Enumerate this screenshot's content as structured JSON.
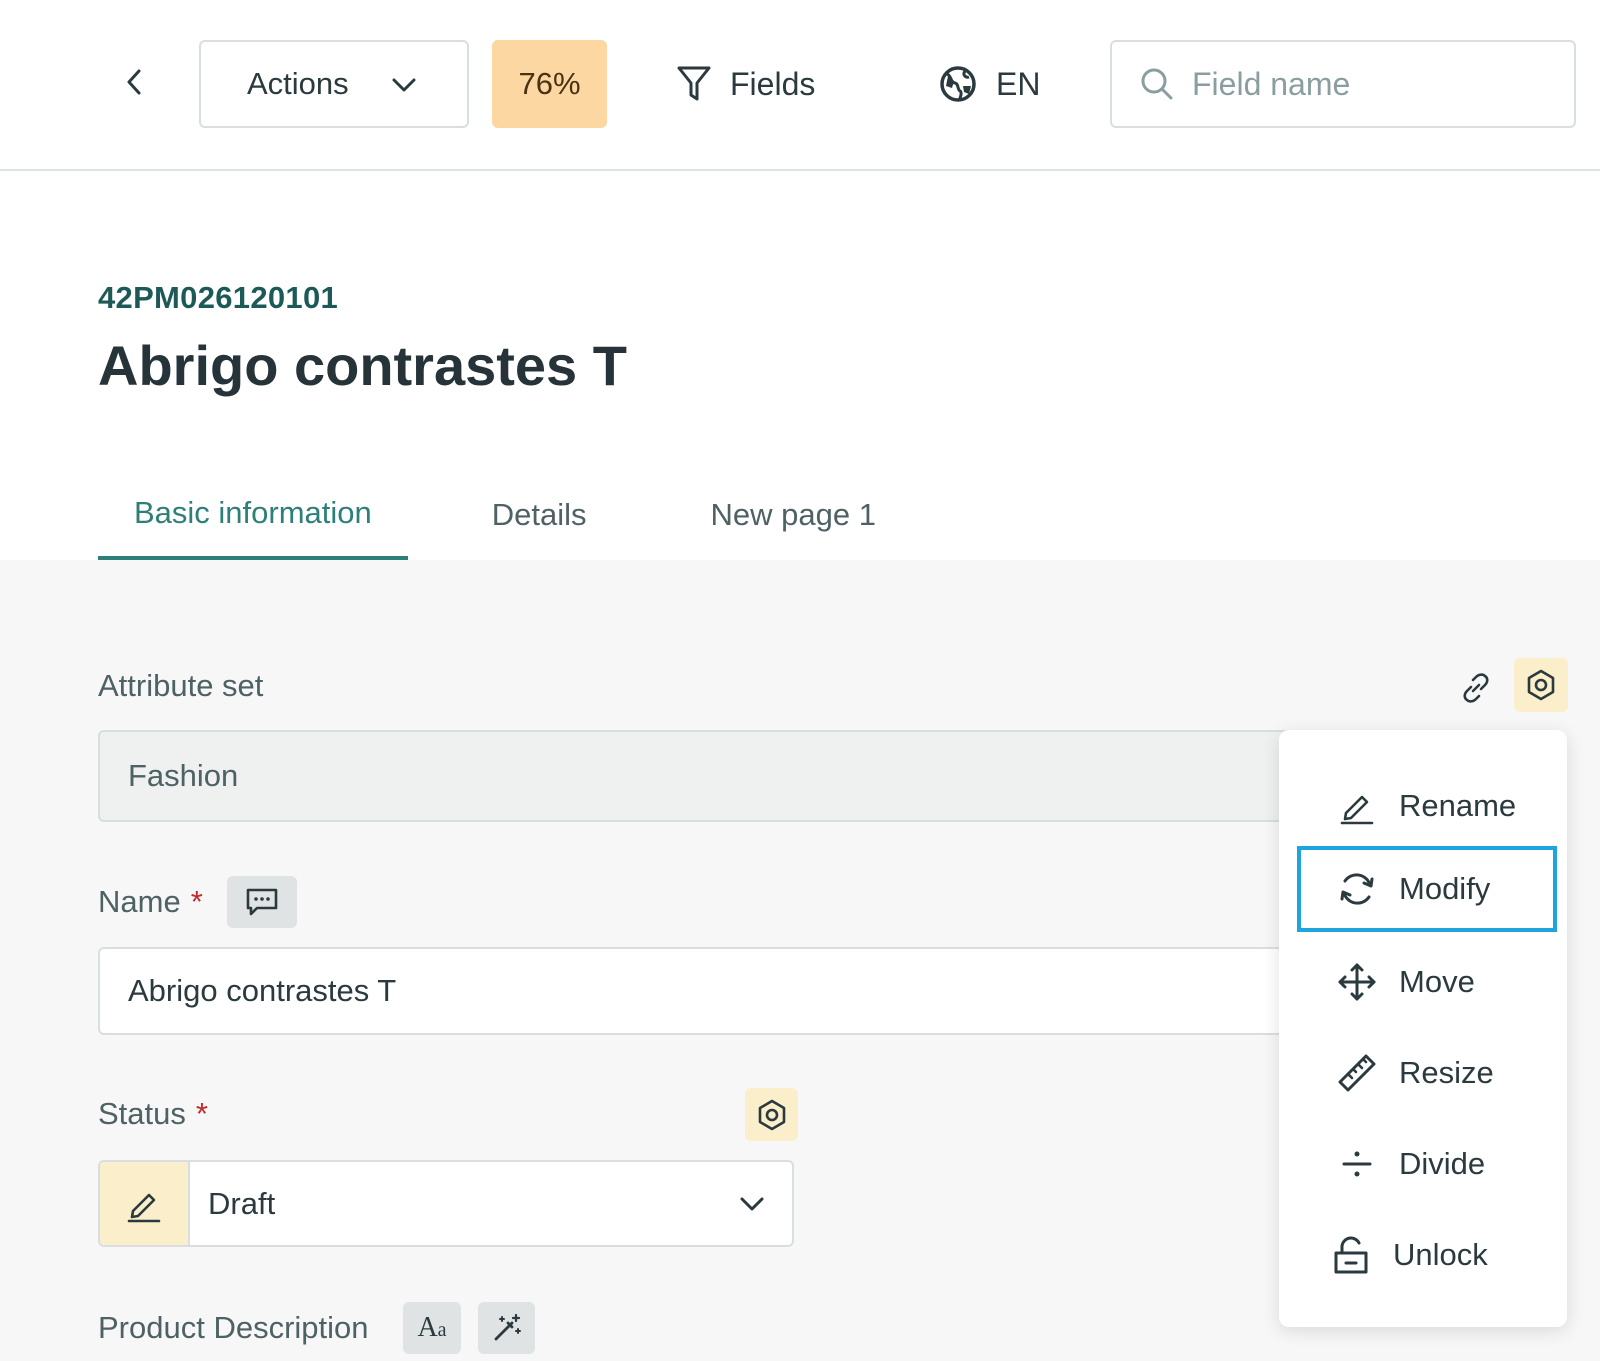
{
  "toolbar": {
    "actions_label": "Actions",
    "completeness": "76%",
    "fields_label": "Fields",
    "language": "EN",
    "search_placeholder": "Field name",
    "completeness_color": "#fdd7a1"
  },
  "product": {
    "code": "42PM026120101",
    "title": "Abrigo contrastes T"
  },
  "tabs": [
    {
      "label": "Basic information",
      "active": true
    },
    {
      "label": "Details",
      "active": false
    },
    {
      "label": "New page 1",
      "active": false
    }
  ],
  "fields": {
    "attribute_set": {
      "label": "Attribute set",
      "value": "Fashion"
    },
    "name": {
      "label": "Name",
      "required_mark": "*",
      "value": "Abrigo contrastes T"
    },
    "status": {
      "label": "Status",
      "required_mark": "*",
      "value": "Draft"
    },
    "product_description": {
      "label": "Product Description"
    }
  },
  "context_menu": {
    "items": [
      {
        "label": "Rename",
        "icon": "pencil-icon"
      },
      {
        "label": "Modify",
        "icon": "refresh-icon",
        "highlighted": true
      },
      {
        "label": "Move",
        "icon": "move-arrows-icon"
      },
      {
        "label": "Resize",
        "icon": "ruler-icon"
      },
      {
        "label": "Divide",
        "icon": "divide-icon"
      },
      {
        "label": "Unlock",
        "icon": "unlock-icon"
      }
    ]
  },
  "colors": {
    "accent": "#2d7f79",
    "highlight_border": "#1ea5dd",
    "required": "#c62828"
  }
}
